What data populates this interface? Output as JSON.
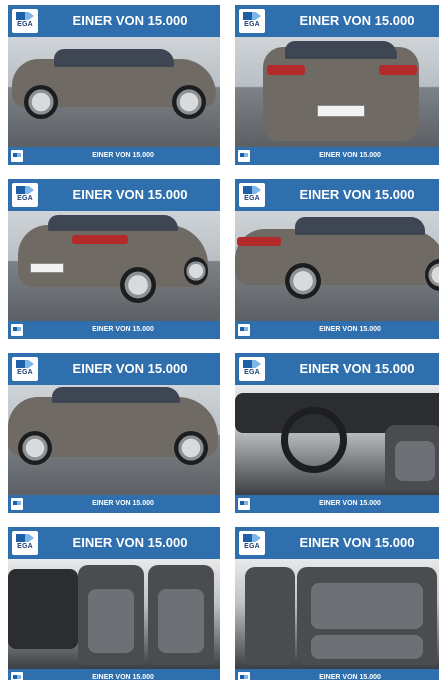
{
  "banner": {
    "logo_text": "EGA",
    "headline": "EINER VON 15.000",
    "footer": "EINER VON 15.000"
  },
  "tiles": [
    {
      "photo": "car side view left",
      "view": "side-left"
    },
    {
      "photo": "car rear view",
      "view": "rear"
    },
    {
      "photo": "car rear three-quarter view",
      "view": "rear-three-quarter"
    },
    {
      "photo": "car side rear view",
      "view": "side-rear"
    },
    {
      "photo": "car side view",
      "view": "side"
    },
    {
      "photo": "car interior dashboard",
      "view": "dashboard"
    },
    {
      "photo": "car front seats",
      "view": "front-seats"
    },
    {
      "photo": "car rear seats",
      "view": "rear-seats"
    }
  ],
  "colors": {
    "banner": "#2f6fae",
    "car": "#6f6a64"
  }
}
